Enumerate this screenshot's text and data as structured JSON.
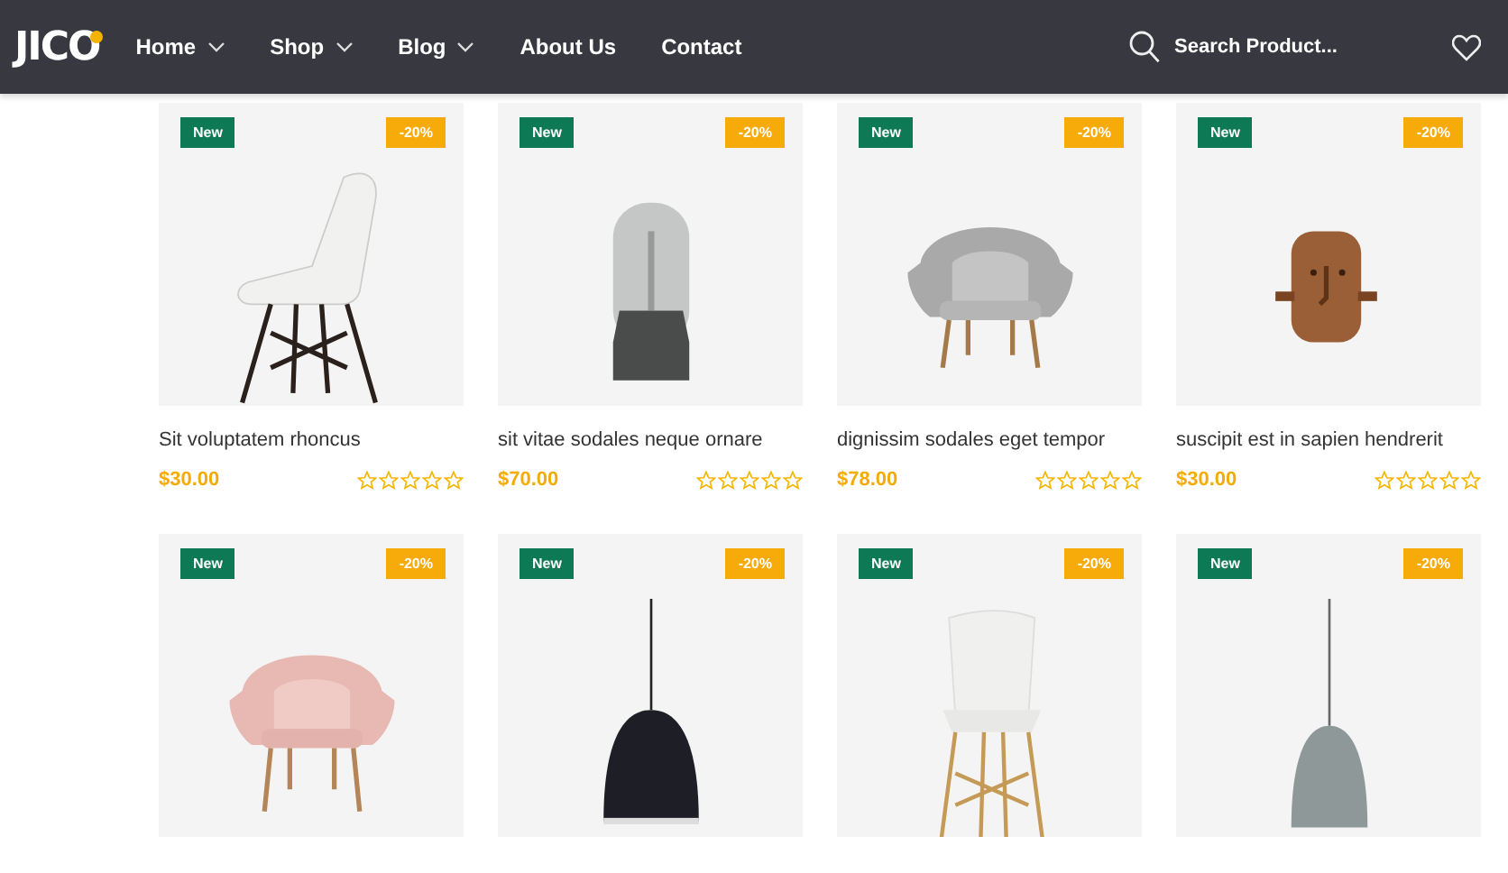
{
  "header": {
    "logo": "JICO",
    "nav": [
      {
        "label": "Home",
        "dropdown": true
      },
      {
        "label": "Shop",
        "dropdown": true
      },
      {
        "label": "Blog",
        "dropdown": true
      },
      {
        "label": "About Us",
        "dropdown": false
      },
      {
        "label": "Contact",
        "dropdown": false
      }
    ],
    "search": {
      "placeholder": "Search Product..."
    }
  },
  "products": [
    {
      "kind": "white-chair",
      "badge": "New",
      "discount": "-20%",
      "name": "Sit voluptatem rhoncus",
      "price": "$30.00",
      "stars": 0
    },
    {
      "kind": "lamp",
      "badge": "New",
      "discount": "-20%",
      "name": "sit vitae sodales neque ornare",
      "price": "$70.00",
      "stars": 0
    },
    {
      "kind": "grey-armchair",
      "badge": "New",
      "discount": "-20%",
      "name": "dignissim sodales eget tempor",
      "price": "$78.00",
      "stars": 0
    },
    {
      "kind": "wood-figure",
      "badge": "New",
      "discount": "-20%",
      "name": "suscipit est in sapien hendrerit",
      "price": "$30.00",
      "stars": 0
    },
    {
      "kind": "pink-armchair",
      "badge": "New",
      "discount": "-20%"
    },
    {
      "kind": "black-pendant",
      "badge": "New",
      "discount": "-20%"
    },
    {
      "kind": "wood-chair",
      "badge": "New",
      "discount": "-20%"
    },
    {
      "kind": "grey-pendant",
      "badge": "New",
      "discount": "-20%"
    }
  ]
}
